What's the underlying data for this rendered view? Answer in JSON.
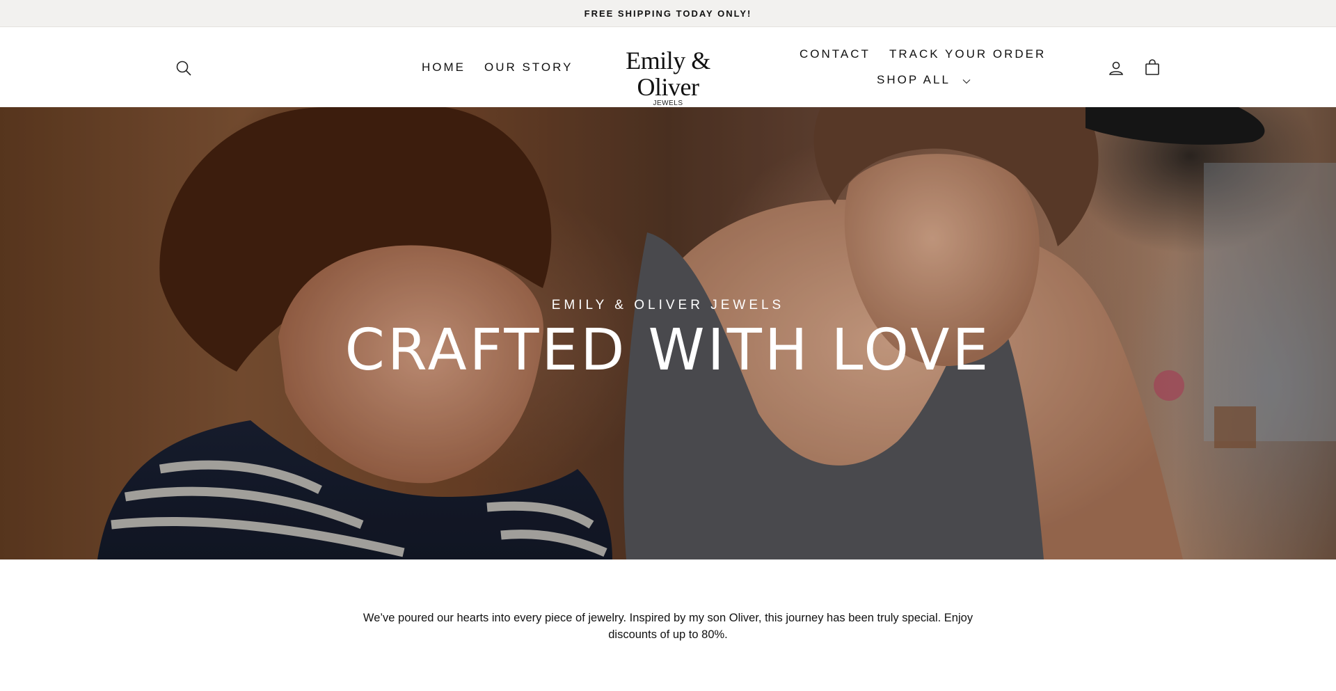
{
  "announcement": {
    "text": "FREE SHIPPING TODAY ONLY!"
  },
  "header": {
    "logo": {
      "name": "Emily & Oliver",
      "sub": "JEWELS"
    },
    "nav_left": [
      {
        "label": "HOME"
      },
      {
        "label": "OUR STORY"
      }
    ],
    "nav_right": [
      {
        "label": "CONTACT"
      },
      {
        "label": "TRACK YOUR ORDER"
      },
      {
        "label": "SHOP ALL"
      }
    ],
    "icons": [
      "search-icon",
      "account-icon",
      "cart-icon",
      "chevron-down-icon"
    ]
  },
  "hero": {
    "eyebrow": "EMILY & OLIVER JEWELS",
    "title": "CRAFTED WITH LOVE"
  },
  "intro": {
    "text": "We’ve poured our hearts into every piece of jewelry. Inspired by my son Oliver, this journey has been truly special. Enjoy discounts of up to 80%."
  }
}
